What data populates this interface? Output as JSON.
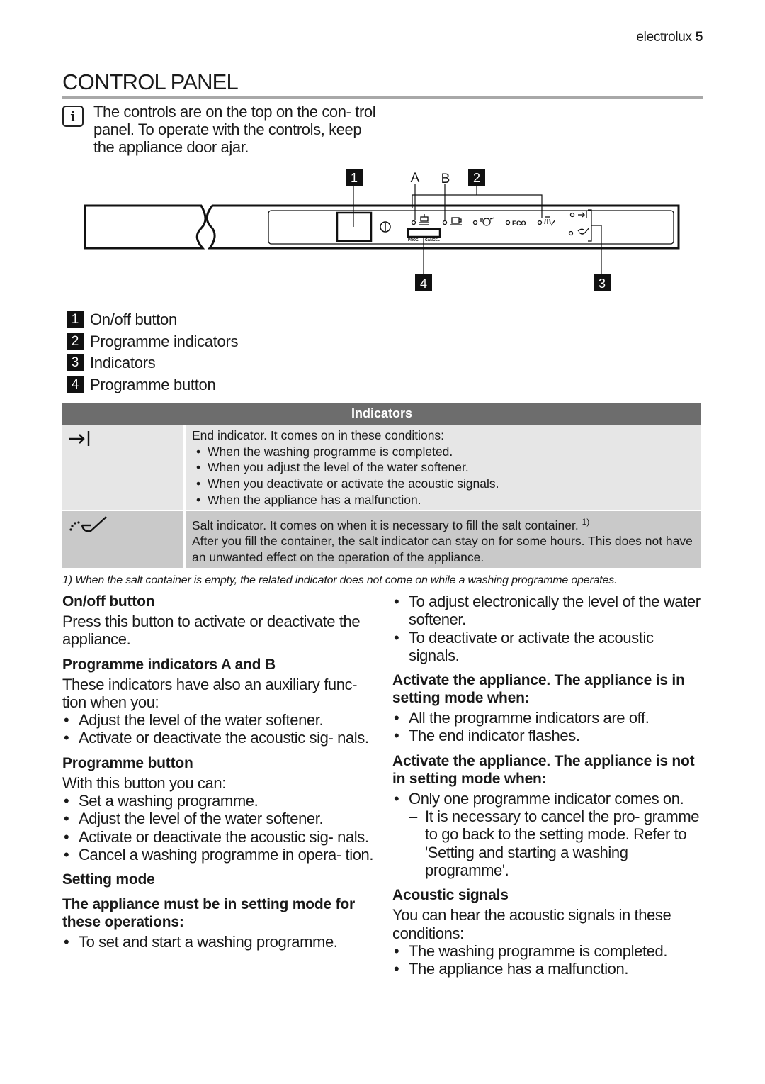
{
  "header": {
    "brand": "electrolux",
    "page_number": "5"
  },
  "section_title": "CONTROL PANEL",
  "info_note": {
    "icon": "info-icon",
    "icon_glyph": "i",
    "text": "The controls are on the top on the con- trol panel. To operate with the controls, keep the appliance door ajar."
  },
  "diagram": {
    "callouts": [
      "1",
      "2",
      "3",
      "4"
    ],
    "letters": [
      "A",
      "B"
    ],
    "panel_labels": {
      "prog": "PROG.",
      "cancel": "CANCEL",
      "eco": "ECO"
    },
    "icons": [
      "on-off-symbol-icon",
      "pots-pans-icon",
      "cup-icon",
      "quick-wash-icon",
      "eco-label",
      "rinse-shower-icon",
      "end-indicator-icon",
      "salt-indicator-icon"
    ]
  },
  "legend": [
    {
      "num": "1",
      "label": "On/off button"
    },
    {
      "num": "2",
      "label": "Programme indicators"
    },
    {
      "num": "3",
      "label": "Indicators"
    },
    {
      "num": "4",
      "label": "Programme button"
    }
  ],
  "indicators_table": {
    "header": "Indicators",
    "rows": [
      {
        "icon": "end-indicator-icon",
        "intro": "End indicator. It comes on in these conditions:",
        "bullets": [
          "When the washing programme is completed.",
          "When you adjust the level of the water softener.",
          "When you deactivate or activate the acoustic signals.",
          "When the appliance has a malfunction."
        ]
      },
      {
        "icon": "salt-indicator-icon",
        "intro": "Salt indicator. It comes on when it is necessary to fill the salt container.",
        "footnote_ref": "1)",
        "text": "After you fill the container, the salt indicator can stay on for some hours. This does not have an unwanted effect on the operation of the appliance."
      }
    ]
  },
  "footnote": "1) When the salt container is empty, the related indicator does not come on while a washing programme operates.",
  "left_column": {
    "onoff": {
      "heading": "On/off button",
      "text": "Press this button to activate or deactivate the appliance."
    },
    "prog_ind": {
      "heading": "Programme indicators A and B",
      "text": "These indicators have also an auxiliary func- tion when you:",
      "bullets": [
        "Adjust the level of the water softener.",
        "Activate or deactivate the acoustic sig- nals."
      ]
    },
    "prog_btn": {
      "heading": "Programme button",
      "text": "With this button you can:",
      "bullets": [
        "Set a washing programme.",
        "Adjust the level of the water softener.",
        "Activate or deactivate the acoustic sig- nals.",
        "Cancel a washing programme in opera- tion."
      ]
    },
    "setting_mode": {
      "heading": "Setting mode",
      "subheading": "The appliance must be in setting mode for these operations:",
      "bullets": [
        "To set and start a washing programme."
      ]
    }
  },
  "right_column": {
    "setting_bullets": [
      "To adjust electronically the level of the water softener.",
      "To deactivate or activate the acoustic signals."
    ],
    "in_setting": {
      "heading": "Activate the appliance. The appliance is in setting mode when:",
      "bullets": [
        "All the programme indicators are off.",
        "The end indicator flashes."
      ]
    },
    "not_setting": {
      "heading": "Activate the appliance. The appliance is not in setting mode when:",
      "bullets": [
        "Only one programme indicator comes on."
      ],
      "dash": "It is necessary to cancel the pro- gramme to go back to the setting mode. Refer to 'Setting and starting a washing programme'."
    },
    "acoustic": {
      "heading": "Acoustic signals",
      "text": "You can hear the acoustic signals in these conditions:",
      "bullets": [
        "The washing programme is completed.",
        "The appliance has a malfunction."
      ]
    }
  }
}
